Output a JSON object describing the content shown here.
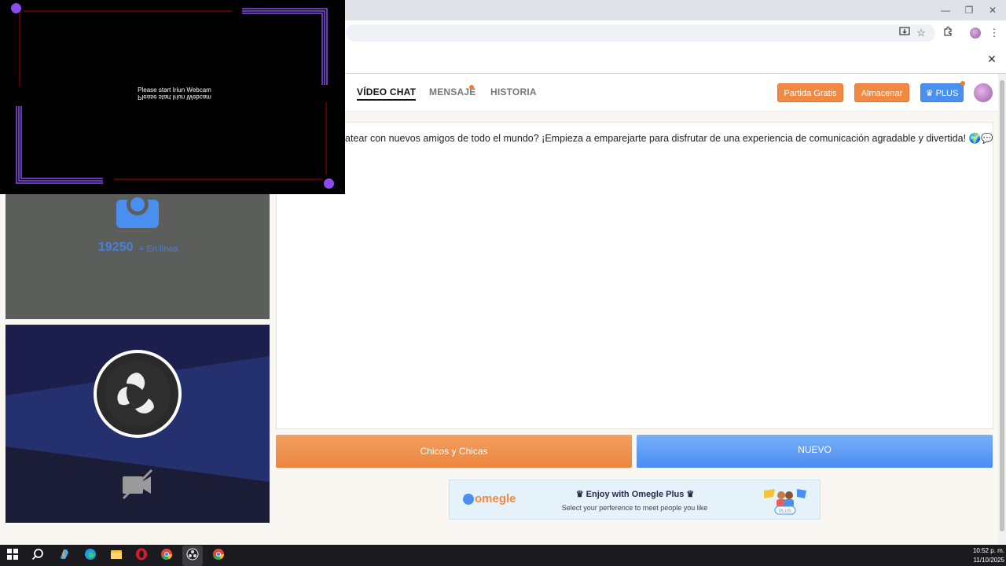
{
  "browser": {
    "window_controls": {
      "minimize": "—",
      "restore": "❐",
      "close": "✕"
    },
    "toolbar_icons": [
      "install-app-icon",
      "bookmark-star-icon",
      "extensions-icon",
      "profile-icon",
      "menu-icon"
    ],
    "notification_close": "✕"
  },
  "header": {
    "nav": [
      {
        "label": "VÍDEO CHAT",
        "active": true
      },
      {
        "label": "MENSAJE",
        "badge": true
      },
      {
        "label": "HISTORIA"
      }
    ],
    "buttons": {
      "partida": "Partida Gratis",
      "almacenar": "Almacenar",
      "plus": "♛ PLUS"
    }
  },
  "overlay": {
    "text": "Please start Iriun Webcam",
    "text_mirrored": "Please start Iriun Webcam"
  },
  "remote_pane": {
    "online_count": "19250",
    "online_label": "+ En línea"
  },
  "chat": {
    "welcome": "atear con nuevos amigos de todo el mundo? ¡Empieza a emparejarte para disfrutar de una experiencia de comunicación agradable y divertida! 🌍💬"
  },
  "actions": {
    "gender": "Chicos y Chicas",
    "new": "NUEVO"
  },
  "banner": {
    "logo": "omegle",
    "title": "♛ Enjoy with Omegle Plus ♛",
    "subtitle": "Select your perference to meet people you like"
  },
  "taskbar": {
    "time": "10:52 p. m.",
    "date": "11/10/2025"
  },
  "colors": {
    "accent_orange": "#f08a42",
    "accent_blue": "#4a90f0",
    "overlay_border": "#8a4cf0"
  }
}
